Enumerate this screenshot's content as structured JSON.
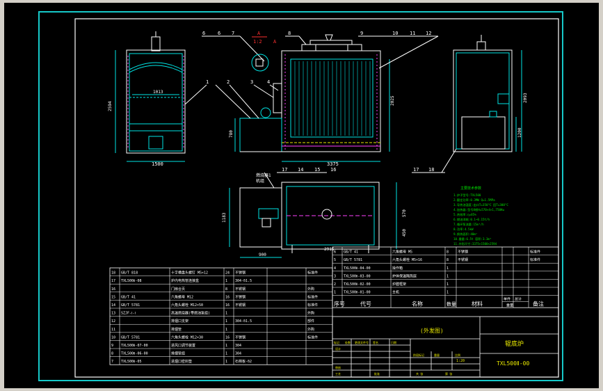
{
  "colors": {
    "background": "#d4d0c8",
    "canvas": "#000000",
    "frame": "#ffffff",
    "frame_accent": "#16c9c9",
    "drawing_cyan": "#00e5e5",
    "drawing_white": "#ffffff",
    "label_yellow": "#e8e800",
    "notes_green": "#00e000",
    "hatch_magenta": "#ff40ff",
    "dimension_red": "#ff3030"
  },
  "callouts": {
    "top_left": [
      "6",
      "6",
      "7"
    ],
    "top_mid": [
      "8"
    ],
    "top_right": [
      "9",
      "10",
      "11",
      "12"
    ],
    "section_label": "A",
    "section_scale": "1:2",
    "section_view_label": "A",
    "front_view": [
      "1",
      "2",
      "3",
      "4"
    ],
    "bottom_right": [
      "17",
      "18"
    ],
    "plan_view": [
      "17",
      "14",
      "15",
      "16"
    ]
  },
  "dimensions": {
    "left_width": "1500",
    "left_inner": "1013",
    "left_height": "2594",
    "front_width": "3375",
    "front_height": "2025",
    "front_small": "780",
    "right_height": "2093",
    "right_lower": "1200",
    "plan_height": "1183",
    "plan_width": "2915",
    "plan_left": "900",
    "plan_right_a": "570",
    "plan_right_b": "450"
  },
  "inlet_label": "燃烧器1",
  "inlet_sub": "机组",
  "notes": {
    "title": "主要技术参数",
    "lines": [
      "1.炉子型号:TXL500",
      "2.额定功率:0.3MW  Q=1.5MPa",
      "3.导热油温度:出口T=350°C  回T=300°C",
      "4.加热器:型号8根H=570×4×1,750Kw",
      "5.热效率:η=85%",
      "6.燃油消耗:0.1~0.15t/h",
      "7.循环泵流量:15m³/h",
      "8.功率:4.5kW",
      "9.换热面积:40m²",
      "10.重量:6.5t  容积:3.3m³",
      "11.外形尺寸:3375×1500×2594"
    ]
  },
  "bom_left": {
    "rows": [
      {
        "no": "18",
        "code": "GB/T 818",
        "name": "十字槽盘头螺钉 M5×12",
        "qty": "24",
        "material": "不锈钢",
        "note": "标准件"
      },
      {
        "no": "17",
        "code": "TXL500Ⅱ-08",
        "name": "炉内电热管连接盒",
        "qty": "1",
        "material": "304-δ1.5",
        "note": ""
      },
      {
        "no": "16",
        "code": "",
        "name": "门扇合页",
        "qty": "8",
        "material": "不锈钢",
        "note": "外购"
      },
      {
        "no": "15",
        "code": "GB/T 41",
        "name": "六角螺母 M12",
        "qty": "16",
        "material": "不锈钢",
        "note": "标准件"
      },
      {
        "no": "14",
        "code": "GB/T 5781",
        "name": "六角头螺栓 M12×50",
        "qty": "16",
        "material": "不锈钢",
        "note": "标准件"
      },
      {
        "no": "13",
        "code": "SZJF-Ⅰ-Ⅰ",
        "name": "高温燃烧器(带燃油泵组)",
        "qty": "1",
        "material": "",
        "note": "外购"
      },
      {
        "no": "12",
        "code": "",
        "name": "排烟口支架",
        "qty": "1",
        "material": "304-δ1.5",
        "note": "部件"
      },
      {
        "no": "11",
        "code": "",
        "name": "排烟管",
        "qty": "1",
        "material": "",
        "note": "外购"
      },
      {
        "no": "10",
        "code": "GB/T 5781",
        "name": "六角头螺栓 M12×30",
        "qty": "16",
        "material": "不锈钢",
        "note": "标准件"
      },
      {
        "no": "9",
        "code": "TXL500Ⅱ-07-00",
        "name": "进风口调节装置",
        "qty": "1",
        "material": "304",
        "note": ""
      },
      {
        "no": "8",
        "code": "TXL500Ⅱ-06-00",
        "name": "排烟管组",
        "qty": "1",
        "material": "304",
        "note": ""
      },
      {
        "no": "7",
        "code": "TXL500Ⅱ-05",
        "name": "进烟口密封垫",
        "qty": "1",
        "material": "石棉板-δ2",
        "note": ""
      }
    ]
  },
  "bom_right": {
    "rows": [
      {
        "no": "6",
        "code": "GB/T 41",
        "name": "六角螺母 M5",
        "qty": "8",
        "material": "不锈钢",
        "note": "标准件"
      },
      {
        "no": "5",
        "code": "GB/T 5781",
        "name": "六角头螺栓 M5×16",
        "qty": "8",
        "material": "不锈钢",
        "note": "标准件"
      },
      {
        "no": "4",
        "code": "TXL500Ⅱ-04-00",
        "name": "操作箱",
        "qty": "1",
        "material": "",
        "note": ""
      },
      {
        "no": "3",
        "code": "TXL500Ⅱ-03-00",
        "name": "炉体保温隔热层",
        "qty": "1",
        "material": "",
        "note": ""
      },
      {
        "no": "2",
        "code": "TXL500Ⅱ-02-00",
        "name": "炉膛框架",
        "qty": "1",
        "material": "",
        "note": ""
      },
      {
        "no": "1",
        "code": "TXL500Ⅱ-01-00",
        "name": "主机",
        "qty": "1",
        "material": "",
        "note": ""
      }
    ],
    "header": {
      "no": "序号",
      "code": "代号",
      "name": "名称",
      "qty": "数量",
      "material": "材料",
      "unit": "单件",
      "total": "总计",
      "mass": "重量",
      "note": "备注"
    }
  },
  "title_block": {
    "unit": "(外发图)",
    "product": "辊底炉",
    "drawing_no": "TXL500Ⅱ-00",
    "small": [
      "标记",
      "处数",
      "更改文件号",
      "签名",
      "日期",
      "设计",
      "审核",
      "工艺",
      "批准",
      "阶段标记",
      "重量",
      "比例",
      "共 张",
      "第 张"
    ],
    "scale": "1:20"
  }
}
